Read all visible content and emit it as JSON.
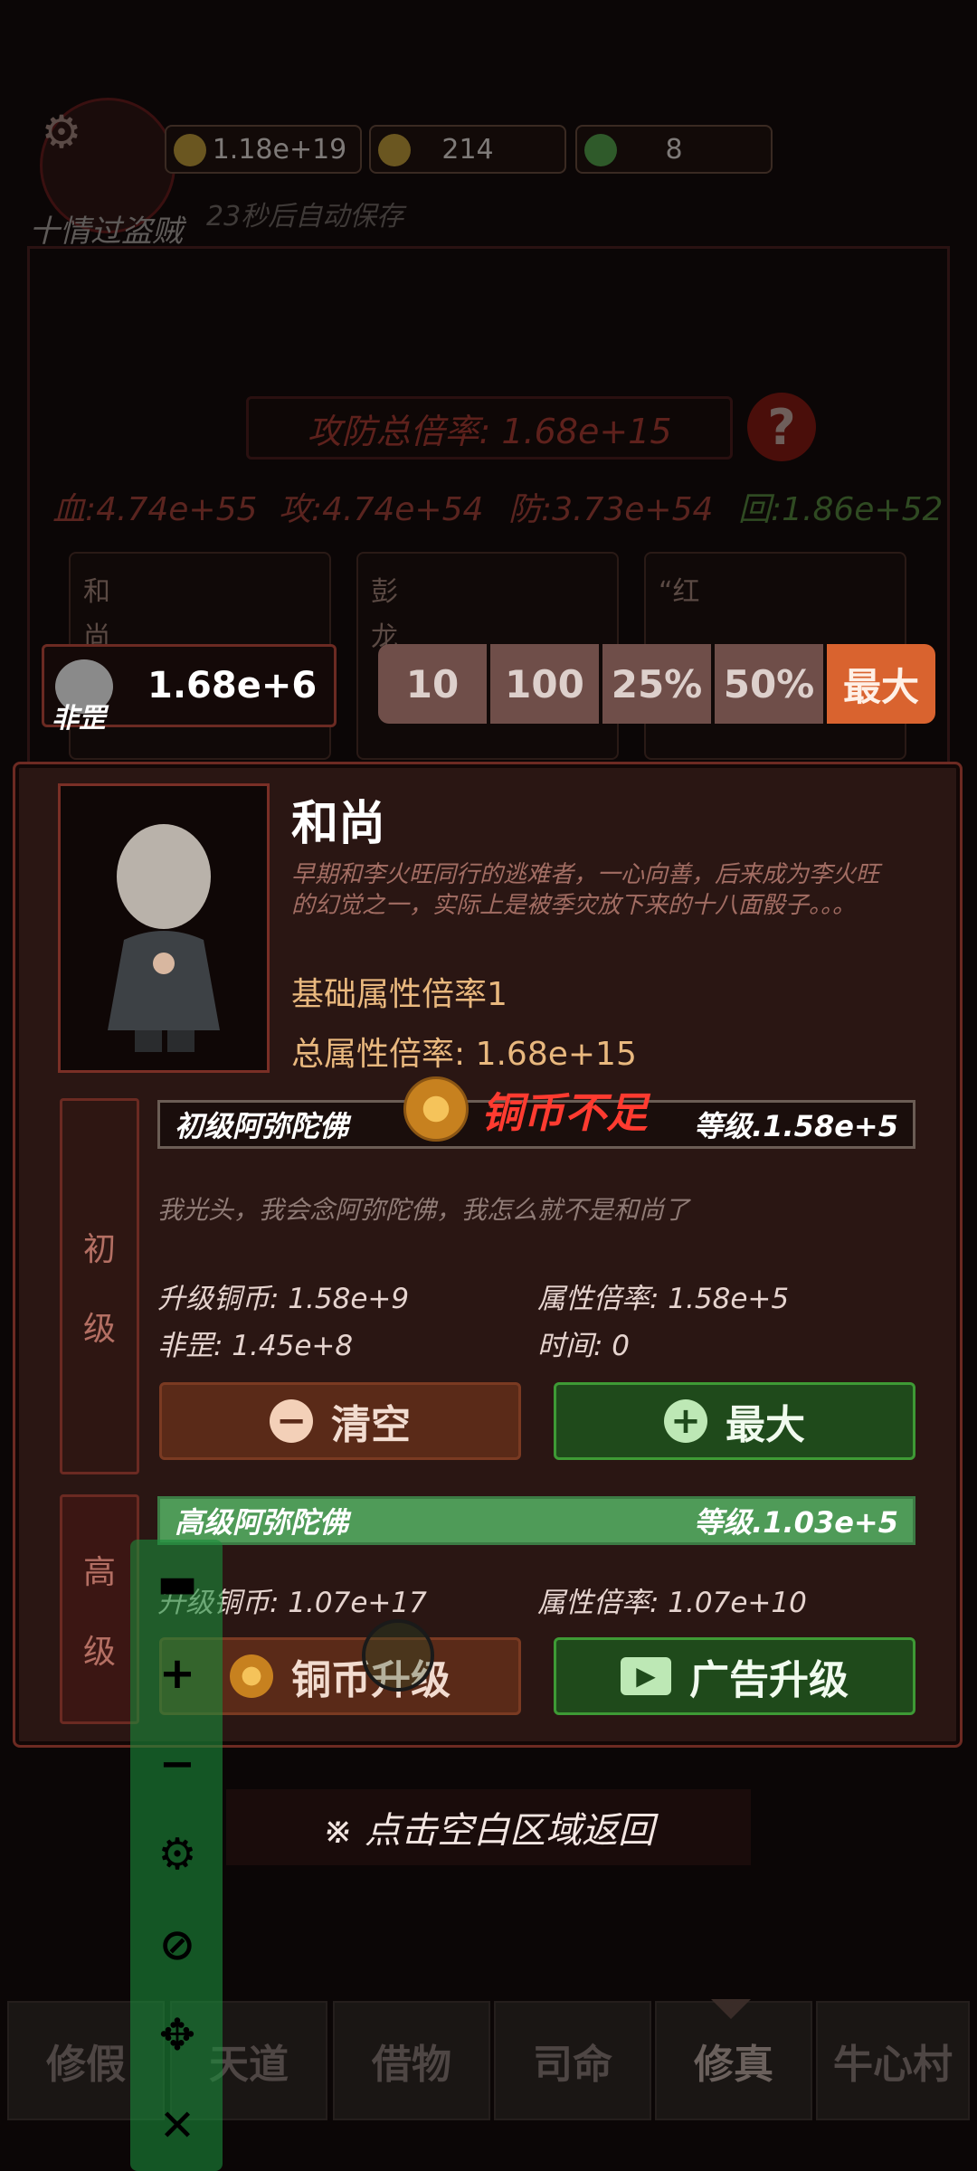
{
  "header": {
    "coins": "1.18e+19",
    "gold": "214",
    "jade": "8",
    "player_name": "十情过盗贼",
    "autosave": "23秒后自动保存",
    "gear_icon": "gear-icon"
  },
  "stats": {
    "total_rate": "攻防总倍率: 1.68e+15",
    "hp": "血:4.74e+55",
    "atk": "攻:4.74e+54",
    "def": "防:3.73e+54",
    "regen": "回:1.86e+52",
    "help_icon": "?"
  },
  "cards": [
    {
      "name": "和尚"
    },
    {
      "name": "彭龙"
    },
    {
      "name": "“红"
    }
  ],
  "amount_bar": {
    "currency_label": "非罡",
    "value": "1.68e+6",
    "options": [
      "10",
      "100",
      "25%",
      "50%",
      "最大"
    ]
  },
  "character": {
    "name": "和尚",
    "description": "早期和李火旺同行的逃难者，一心向善，后来成为李火旺的幻觉之一，实际上是被季灾放下来的十八面骰子。。。",
    "base_rate": "基础属性倍率1",
    "total_rate": "总属性倍率: 1.68e+15"
  },
  "tier_basic": {
    "col_label_1": "初",
    "col_label_2": "级",
    "skill_name": "初级阿弥陀佛",
    "level": "等级.1.58e+5",
    "warning": "铜币不足",
    "flavor": "我光头，我会念阿弥陀佛，我怎么就不是和尚了",
    "upgrade_cost": "升级铜币: 1.58e+9",
    "attr_rate": "属性倍率: 1.58e+5",
    "feigang": "非罡: 1.45e+8",
    "time": "时间: 0",
    "clear_label": "清空",
    "max_label": "最大"
  },
  "tier_advanced": {
    "col_label_1": "高",
    "col_label_2": "级",
    "skill_name": "高级阿弥陀佛",
    "level": "等级.1.03e+5",
    "upgrade_cost": "升级铜币: 1.07e+17",
    "attr_rate": "属性倍率: 1.07e+10",
    "coin_upgrade_label": "铜币升级",
    "ad_upgrade_label": "广告升级"
  },
  "return_hint": "※ 点击空白区域返回",
  "bottom_tabs": [
    "修假",
    "天道",
    "借物",
    "司命",
    "修真",
    "牛心村"
  ],
  "colors": {
    "accent_orange": "#d9632f",
    "green_btn": "#1f4a1b",
    "warning_red": "#ff3b30",
    "gold_text": "#e9b87e"
  }
}
